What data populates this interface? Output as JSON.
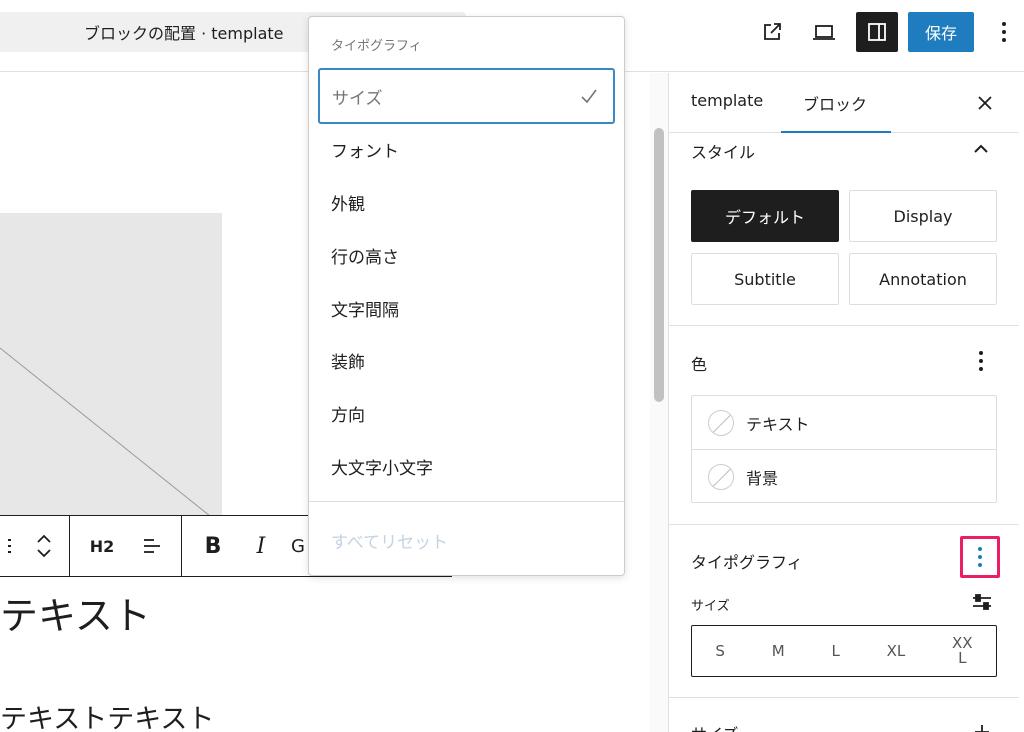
{
  "header": {
    "doc_title": "ブロックの配置 · template",
    "save_label": "保存"
  },
  "canvas": {
    "toolbar": {
      "heading_level": "H2",
      "bold": "B",
      "italic": "I",
      "link": "G"
    },
    "heading_text": "テキスト",
    "paragraph_text": "テキストテキスト"
  },
  "dropdown": {
    "header": "タイポグラフィ",
    "selected": "サイズ",
    "items": [
      "フォント",
      "外観",
      "行の高さ",
      "文字間隔",
      "装飾",
      "方向",
      "大文字小文字"
    ],
    "reset": "すべてリセット"
  },
  "sidebar": {
    "tabs": [
      "template",
      "ブロック"
    ],
    "active_tab": "ブロック",
    "styles_title": "スタイル",
    "styles": [
      "デフォルト",
      "Display",
      "Subtitle",
      "Annotation"
    ],
    "color_title": "色",
    "colors": [
      "テキスト",
      "背景"
    ],
    "typography_title": "タイポグラフィ",
    "size_label": "サイズ",
    "sizes": [
      "S",
      "M",
      "L",
      "XL",
      "XX\nL"
    ],
    "next_section_title": "サイズ"
  },
  "colors": {
    "accent": "#1f7dbf",
    "highlight": "#e91e63",
    "dark": "#1e1e1e"
  }
}
